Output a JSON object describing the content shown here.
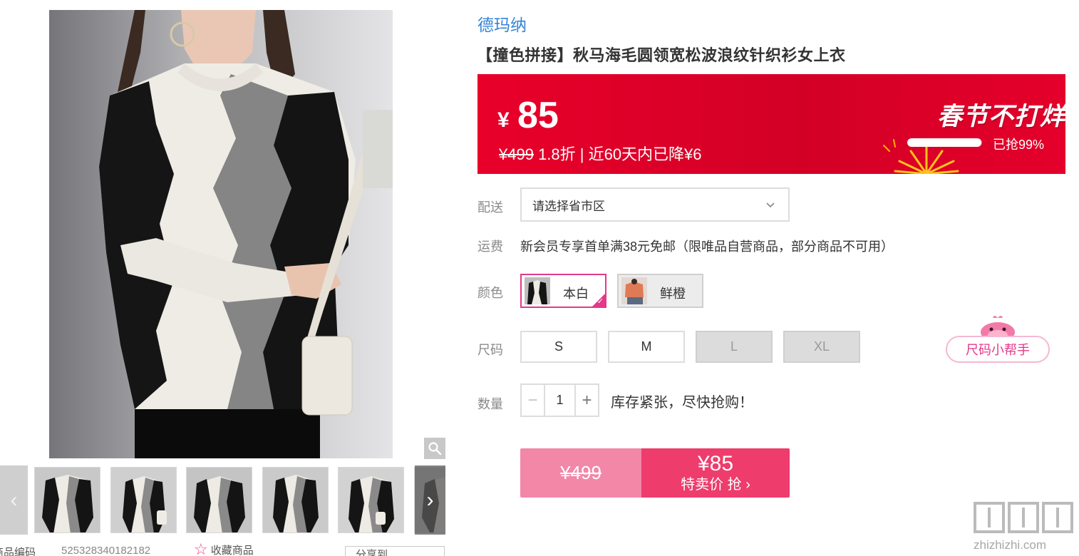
{
  "gallery": {
    "thumbnail_count": 6,
    "prev_arrow": "‹",
    "next_arrow": "›",
    "product_code_label": "商品编码",
    "product_code_value": "525328340182182",
    "favorite_label": "收藏商品",
    "share_label": "分享到"
  },
  "product": {
    "brand": "德玛纳",
    "title": "【撞色拼接】秋马海毛圆领宽松波浪纹针织衫女上衣"
  },
  "price_banner": {
    "currency": "¥",
    "price": "85",
    "original_price": "¥499",
    "discount_text": " 1.8折 | 近60天内已降¥6",
    "promo_text": "春节不打烊",
    "sold_progress_percent": 99,
    "sold_text": "已抢99%",
    "colors": {
      "banner": "#e00028",
      "text": "#ffffff"
    }
  },
  "delivery": {
    "label": "配送",
    "select_placeholder": "请选择省市区"
  },
  "shipping": {
    "label": "运费",
    "text": "新会员专享首单满38元免邮（限唯品自营商品，部分商品不可用）"
  },
  "color": {
    "label": "颜色",
    "options": [
      {
        "name": "本白",
        "selected": true
      },
      {
        "name": "鲜橙",
        "selected": false
      }
    ],
    "accent": "#e4388a"
  },
  "size": {
    "label": "尺码",
    "options": [
      {
        "name": "S",
        "available": true
      },
      {
        "name": "M",
        "available": true
      },
      {
        "name": "L",
        "available": false
      },
      {
        "name": "XL",
        "available": false
      }
    ],
    "helper_label": "尺码小帮手"
  },
  "quantity": {
    "label": "数量",
    "minus": "−",
    "plus": "+",
    "value": "1",
    "stock_note": "库存紧张，尽快抢购！"
  },
  "buy": {
    "original_price": "¥499",
    "price": "¥85",
    "label": "特卖价 抢 ›",
    "colors": {
      "left": "#f287a7",
      "right": "#ee3c6c"
    }
  },
  "watermark": {
    "logo": "值值值",
    "url": "zhizhizhi.com"
  }
}
